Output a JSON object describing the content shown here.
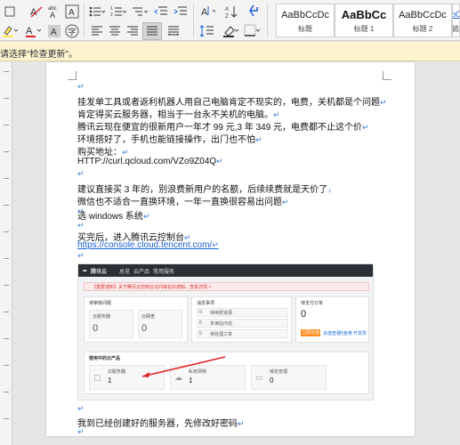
{
  "styles": [
    {
      "sample": "AaBbCcDc",
      "name": "标题"
    },
    {
      "sample": "AaBbCc",
      "name": "标题 1"
    },
    {
      "sample": "AaBbCcDc",
      "name": "标题 2"
    },
    {
      "sample": "AaBbCcDc",
      "name": "超链接"
    }
  ],
  "notify": {
    "text": "请选择\"检查更新\"。"
  },
  "paragraphs": [
    "挂发单工具或者返利机器人用自己电脑肯定不现实的，电费，关机都是个问题",
    "肯定得买云服务器，相当于一台永不关机的电脑。",
    "腾讯云现在便宜的很新用户一年才 99 元,3 年 349 元，电费都不止这个价",
    "环境搭好了，手机也能链接操作，出门也不怕",
    "购买地址：",
    "HTTP://curl.qcloud.com/VZo9Z04Q",
    "",
    "建议直接买 3 年的，别浪费新用户的名额，后续续费就是天价了",
    "微信也不适合一直换环境，一年一直换很容易出问题",
    "",
    "选 windows 系统",
    "",
    "买完后，进入腾讯云控制台",
    "https://console.cloud.tencent.com/",
    "",
    "我到已经创建好的服务器，先修改好密码"
  ],
  "screenshot": {
    "logo": "腾讯云",
    "nav": [
      "总览",
      "云产品",
      "常用服务"
    ],
    "alert": "【重要通知】关于腾讯云控制台访问域名的通知，查看详情 >",
    "cards": [
      {
        "title": "待审核问题",
        "items": [
          {
            "label": "云服务器",
            "value": "0"
          },
          {
            "label": "云硬盘",
            "value": "0"
          }
        ]
      },
      {
        "title": "消息事项",
        "items": [
          {
            "label": "待续费资源",
            "value": "0"
          },
          {
            "label": "未读站内信",
            "value": "0"
          },
          {
            "label": "待处理工单",
            "value": "0"
          }
        ]
      },
      {
        "title": "待支付订单",
        "value": "0",
        "button": "立即充值",
        "links": [
          "充值查看",
          "代金券",
          "开发票"
        ]
      }
    ],
    "resources_title": "使用中的云产品",
    "resources": [
      {
        "label": "云服务器",
        "value": "1"
      },
      {
        "label": "私有网络",
        "value": "1"
      },
      {
        "label": "域名管理",
        "value": "0"
      }
    ]
  },
  "colors": {
    "link": "#1a5fd6",
    "notify_bg": "#fdf3cf",
    "accent_orange": "#ff8c1a",
    "arrow_red": "#e02020"
  }
}
